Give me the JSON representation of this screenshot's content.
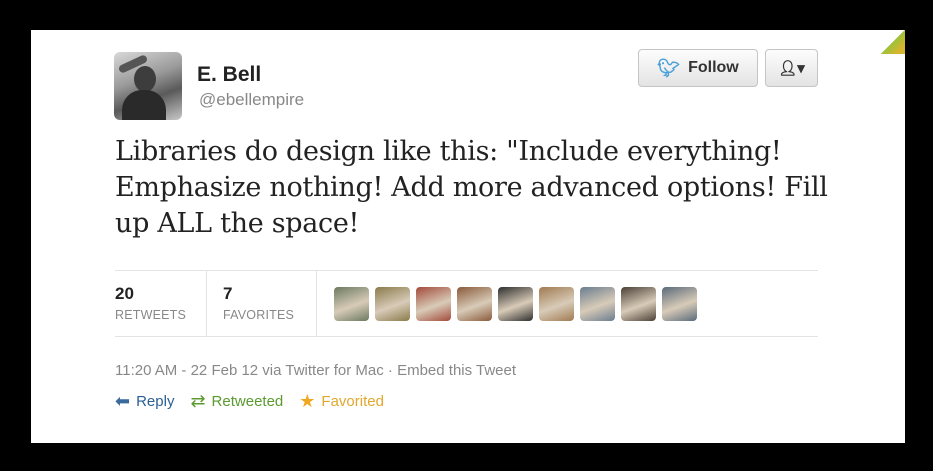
{
  "user": {
    "name": "E. Bell",
    "handle": "@ebellempire"
  },
  "buttons": {
    "follow_label": "Follow",
    "user_menu_icon": "user-dropdown-icon"
  },
  "tweet": {
    "text": "Libraries do design like this: \"Include everything! Emphasize nothing! Add more advanced options! Fill up ALL the space!"
  },
  "stats": {
    "retweets_count": "20",
    "retweets_label": "RETWEETS",
    "favorites_count": "7",
    "favorites_label": "FAVORITES"
  },
  "faces": [
    {
      "color": "#6b7a5f"
    },
    {
      "color": "#8a7a4a"
    },
    {
      "color": "#a34a3a"
    },
    {
      "color": "#8a5a3a"
    },
    {
      "color": "#2e2e2e"
    },
    {
      "color": "#a07a50"
    },
    {
      "color": "#6a7d8f"
    },
    {
      "color": "#4a4036"
    },
    {
      "color": "#5a6a7a"
    }
  ],
  "meta": {
    "timestamp": "11:20 AM - 22 Feb 12 via Twitter for Mac",
    "separator": " · ",
    "embed_label": "Embed this Tweet"
  },
  "actions": {
    "reply_label": "Reply",
    "retweeted_label": "Retweeted",
    "favorited_label": "Favorited"
  },
  "colors": {
    "link": "#2a5f96",
    "retweeted": "#5b9a2f",
    "favorited": "#e0a82e",
    "twitter_bird": "#4aa0d8"
  }
}
